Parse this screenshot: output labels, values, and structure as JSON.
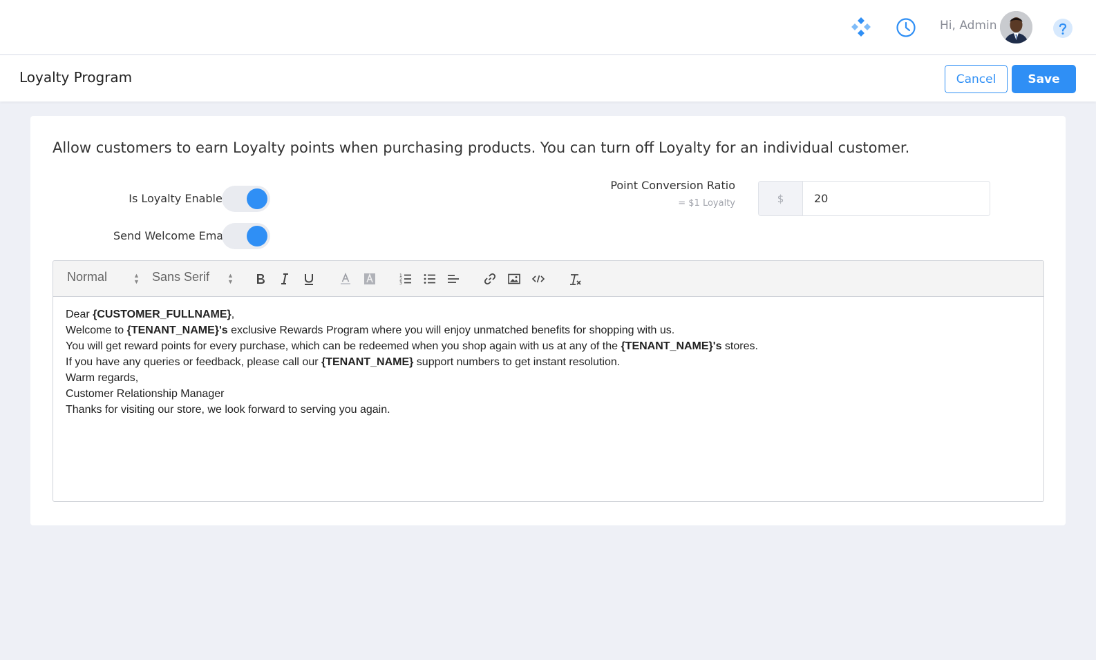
{
  "header": {
    "greeting": "Hi, Admin",
    "icons": [
      "apps-icon",
      "clock-icon",
      "avatar",
      "help-icon"
    ],
    "accent": "#2f8ff5"
  },
  "page": {
    "title": "Loyalty Program",
    "cancel_label": "Cancel",
    "save_label": "Save"
  },
  "settings": {
    "description": "Allow customers to earn Loyalty points when purchasing products. You can turn off Loyalty for an individual customer.",
    "loyalty_enabled_label": "Is Loyalty Enabled",
    "loyalty_enabled": true,
    "welcome_email_label": "Send Welcome Email",
    "welcome_email": true,
    "ratio_label": "Point Conversion Ratio",
    "ratio_sub": "= $1 Loyalty",
    "ratio_prefix": "$",
    "ratio_value": "20"
  },
  "editor": {
    "size_select": "Normal",
    "font_select": "Sans Serif",
    "toolbar_icons": [
      "bold-icon",
      "italic-icon",
      "underline-icon",
      "text-color-icon",
      "background-color-icon",
      "ordered-list-icon",
      "bullet-list-icon",
      "align-icon",
      "link-icon",
      "image-icon",
      "code-icon",
      "clear-format-icon"
    ],
    "lines": [
      [
        {
          "t": "Dear "
        },
        {
          "t": "{CUSTOMER_FULLNAME}",
          "b": true
        },
        {
          "t": ","
        }
      ],
      [
        {
          "t": "Welcome to "
        },
        {
          "t": "{TENANT_NAME}'s",
          "b": true
        },
        {
          "t": " exclusive Rewards Program where you will enjoy unmatched benefits for shopping with us."
        }
      ],
      [
        {
          "t": "You will get reward points for every purchase, which can be redeemed when you shop again with us at any of the "
        },
        {
          "t": "{TENANT_NAME}'s",
          "b": true
        },
        {
          "t": " stores."
        }
      ],
      [
        {
          "t": "If you have any queries or feedback, please call our "
        },
        {
          "t": "{TENANT_NAME}",
          "b": true
        },
        {
          "t": " support numbers to get instant resolution."
        }
      ],
      [
        {
          "t": "Warm regards,"
        }
      ],
      [
        {
          "t": "Customer Relationship Manager"
        }
      ],
      [
        {
          "t": "Thanks for visiting our store, we look forward to serving you again."
        }
      ]
    ]
  }
}
